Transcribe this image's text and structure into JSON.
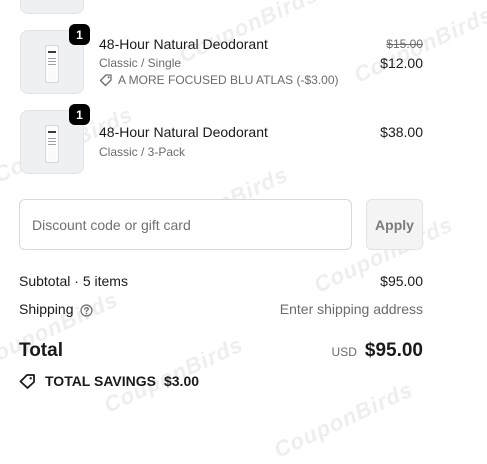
{
  "items": [
    {
      "quantity": "1",
      "title": "48-Hour Natural Deodorant",
      "variant": "Classic / Single",
      "original_price": "$15.00",
      "price": "$12.00",
      "discount": "A MORE FOCUSED BLU ATLAS (-$3.00)"
    },
    {
      "quantity": "1",
      "title": "48-Hour Natural Deodorant",
      "variant": "Classic / 3-Pack",
      "price": "$38.00"
    }
  ],
  "discount_input": {
    "placeholder": "Discount code or gift card",
    "apply_label": "Apply"
  },
  "summary": {
    "subtotal_label": "Subtotal · 5 items",
    "subtotal_value": "$95.00",
    "shipping_label": "Shipping",
    "shipping_value": "Enter shipping address",
    "total_label": "Total",
    "currency": "USD",
    "total_value": "$95.00",
    "savings_label": "TOTAL SAVINGS",
    "savings_value": "$3.00"
  },
  "watermark": "CouponBirds",
  "icons": {
    "discount_tag": "tag-icon",
    "shipping_help": "help-circle-icon",
    "savings_tag": "tag-icon"
  },
  "colors": {
    "badge_bg": "#000000",
    "muted_text": "#6b6b6b",
    "apply_bg": "#f4f4f4"
  }
}
